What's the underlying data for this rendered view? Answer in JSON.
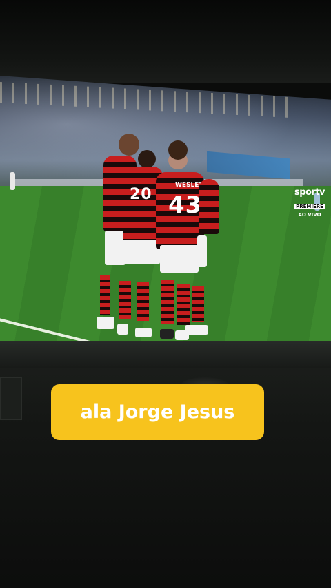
{
  "broadcast": {
    "channel_logo": "sportv",
    "channel_sub": "PREMIERE",
    "live_label": "AO VIVO"
  },
  "players": {
    "front_number": "43",
    "front_name": "WESLEY",
    "second_number": "20"
  },
  "caption": {
    "text": "ala Jorge Jesus",
    "color": "#f7c31d"
  }
}
